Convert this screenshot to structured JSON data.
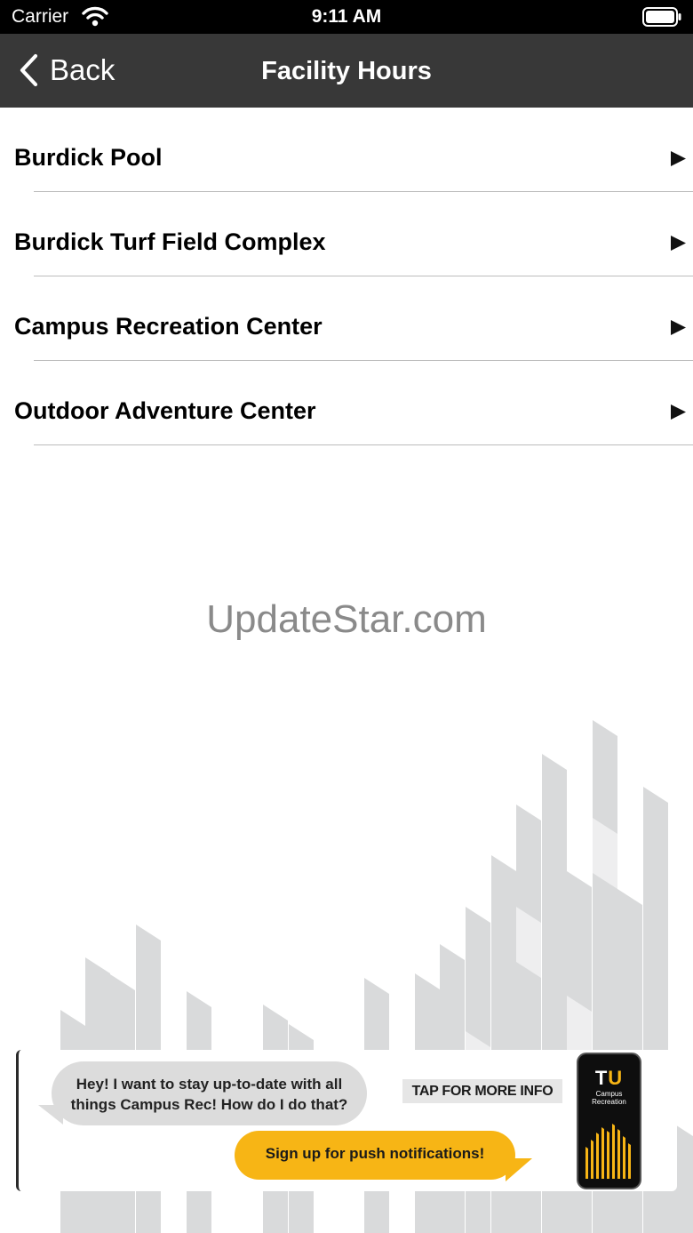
{
  "status_bar": {
    "carrier": "Carrier",
    "time": "9:11 AM",
    "wifi_icon": "wifi-icon",
    "battery_icon": "battery-icon"
  },
  "nav_bar": {
    "back_label": "Back",
    "back_icon": "chevron-left-icon",
    "title": "Facility Hours",
    "background": "#383838"
  },
  "facilities": [
    {
      "label": "Burdick Pool",
      "icon": "disclosure-triangle-icon"
    },
    {
      "label": "Burdick Turf Field Complex",
      "icon": "disclosure-triangle-icon"
    },
    {
      "label": "Campus Recreation Center",
      "icon": "disclosure-triangle-icon"
    },
    {
      "label": "Outdoor Adventure Center",
      "icon": "disclosure-triangle-icon"
    }
  ],
  "watermark": "UpdateStar.com",
  "promo": {
    "question": "Hey! I want to stay up-to-date with all things Campus Rec! How do I do that?",
    "answer": "Sign up for push notifications!",
    "tap_info": "TAP FOR MORE INFO",
    "phone_logo_t": "T",
    "phone_logo_u": "U",
    "phone_caption": "Campus Recreation",
    "accent_color": "#f7b515"
  }
}
